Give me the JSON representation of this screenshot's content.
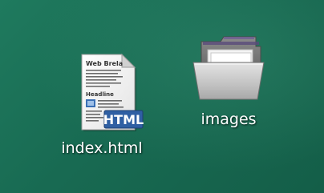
{
  "desktop": {
    "background_color": "#1d7357",
    "icons": [
      {
        "label": "index.html",
        "type": "html-file-icon",
        "badge": "HTML",
        "badge_color": "#2f5fa3",
        "page_title": "Web Brela",
        "page_heading": "Headline"
      },
      {
        "label": "images",
        "type": "folder-open-icon",
        "folder_color": "#bdbdbd",
        "folder_tab_color": "#5a4b7a"
      }
    ]
  }
}
